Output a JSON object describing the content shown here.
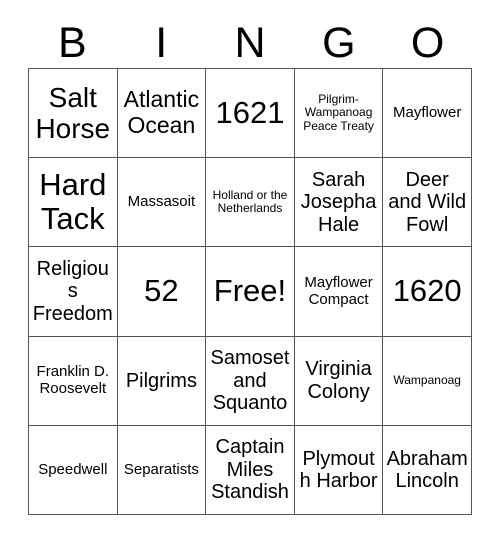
{
  "card": {
    "title": "BINGO Card",
    "header": {
      "letters": [
        "B",
        "I",
        "N",
        "G",
        "O"
      ]
    },
    "grid": {
      "columns": 5,
      "rows": 5,
      "free_space": {
        "row": 2,
        "column": 2,
        "label": "Free!"
      },
      "border_color": "#555555",
      "background_color": "#ffffff",
      "text_color": "#000000",
      "cells": [
        [
          {
            "text": "Salt Horse",
            "size": "xl"
          },
          {
            "text": "Atlantic Ocean",
            "size": "lg"
          },
          {
            "text": "1621",
            "size": "xxl"
          },
          {
            "text": "Pilgrim-Wampanoag Peace Treaty",
            "size": "xs"
          },
          {
            "text": "Mayflower",
            "size": "sm"
          }
        ],
        [
          {
            "text": "Hard Tack",
            "size": "xxl"
          },
          {
            "text": "Massasoit",
            "size": "sm"
          },
          {
            "text": "Holland or the Netherlands",
            "size": "xs"
          },
          {
            "text": "Sarah Josepha Hale",
            "size": "md"
          },
          {
            "text": "Deer and Wild Fowl",
            "size": "md"
          }
        ],
        [
          {
            "text": "Religious Freedom",
            "size": "md"
          },
          {
            "text": "52",
            "size": "xxl"
          },
          {
            "text": "Free!",
            "size": "xxl"
          },
          {
            "text": "Mayflower Compact",
            "size": "sm"
          },
          {
            "text": "1620",
            "size": "xxl"
          }
        ],
        [
          {
            "text": "Franklin D. Roosevelt",
            "size": "sm"
          },
          {
            "text": "Pilgrims",
            "size": "md"
          },
          {
            "text": "Samoset and Squanto",
            "size": "md"
          },
          {
            "text": "Virginia Colony",
            "size": "md"
          },
          {
            "text": "Wampanoag",
            "size": "xs"
          }
        ],
        [
          {
            "text": "Speedwell",
            "size": "sm"
          },
          {
            "text": "Separatists",
            "size": "sm"
          },
          {
            "text": "Captain Miles Standish",
            "size": "md"
          },
          {
            "text": "Plymouth Harbor",
            "size": "md"
          },
          {
            "text": "Abraham Lincoln",
            "size": "md"
          }
        ]
      ]
    }
  }
}
